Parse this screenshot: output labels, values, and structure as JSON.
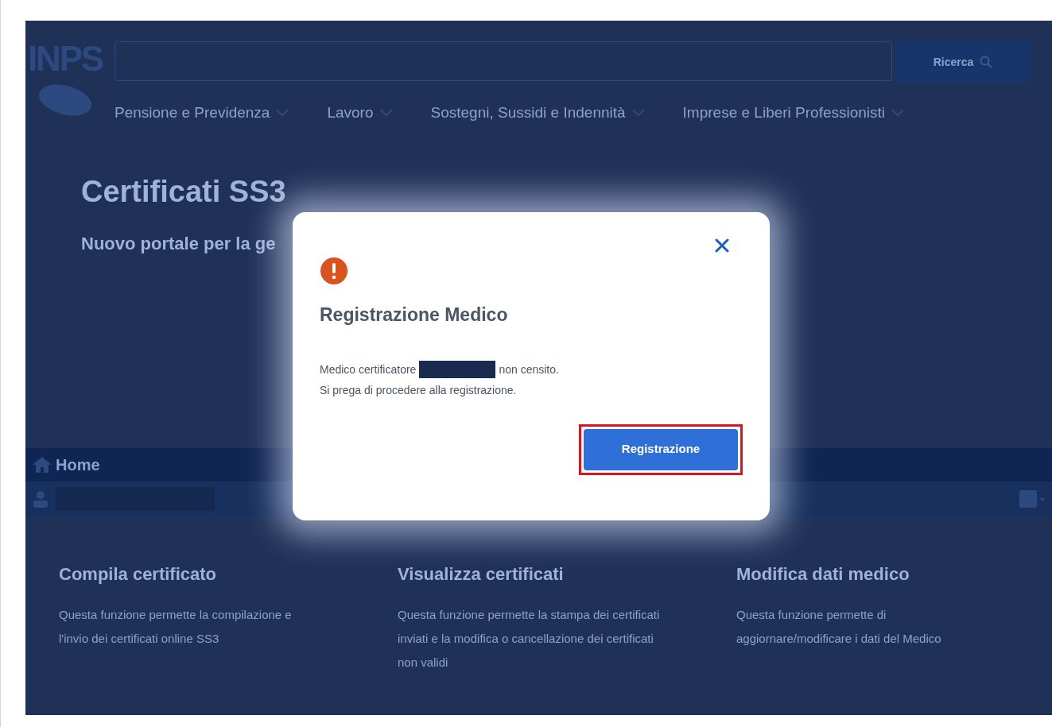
{
  "header": {
    "logo": "INPS",
    "search_button": "Ricerca",
    "nav": [
      {
        "label": "Pensione e Previdenza"
      },
      {
        "label": "Lavoro"
      },
      {
        "label": "Sostegni, Sussidi e Indennità"
      },
      {
        "label": "Imprese e Liberi Professionisti"
      }
    ]
  },
  "hero": {
    "title": "Certificati SS3",
    "subtitle": "Nuovo portale per la ge"
  },
  "breadcrumb": {
    "label": "Home"
  },
  "cards": [
    {
      "title": "Compila certificato",
      "text": "Questa funzione permette la compilazione e l'invio dei certificati online SS3"
    },
    {
      "title": "Visualizza certificati",
      "text": "Questa funzione permette la stampa dei certificati inviati e la modifica o cancellazione dei certificati non validi"
    },
    {
      "title": "Modifica dati medico",
      "text": "Questa funzione permette di aggiornare/modificare i dati del Medico"
    }
  ],
  "dialog": {
    "title": "Registrazione Medico",
    "message_start": "Medico certificatore",
    "message_end": "non censito.",
    "message_line2": "Si prega di procedere alla registrazione.",
    "button": "Registrazione",
    "button_highlighted": true
  }
}
